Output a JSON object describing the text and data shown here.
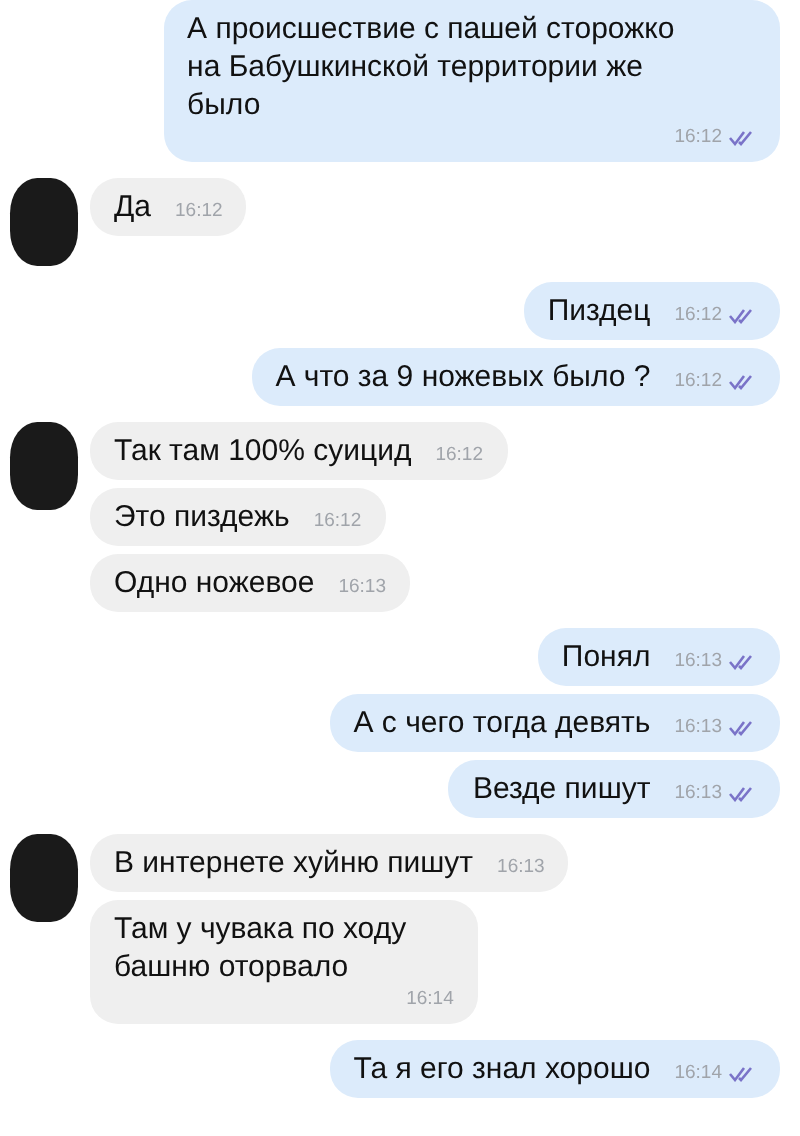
{
  "groups": [
    {
      "kind": "outgoing",
      "messages": [
        {
          "text": "А происшествие с пашей сторожко\nна Бабушкинской территории же\nбыло",
          "time": "16:12",
          "read": true
        }
      ]
    },
    {
      "kind": "incoming",
      "messages": [
        {
          "text": "Да",
          "time": "16:12"
        }
      ]
    },
    {
      "kind": "outgoing",
      "messages": [
        {
          "text": "Пиздец",
          "time": "16:12",
          "read": true
        },
        {
          "text": "А что за 9 ножевых было ?",
          "time": "16:12",
          "read": true
        }
      ]
    },
    {
      "kind": "incoming",
      "messages": [
        {
          "text": "Так там 100% суицид",
          "time": "16:12"
        },
        {
          "text": "Это пиздежь",
          "time": "16:12"
        },
        {
          "text": "Одно ножевое",
          "time": "16:13"
        }
      ]
    },
    {
      "kind": "outgoing",
      "messages": [
        {
          "text": "Понял",
          "time": "16:13",
          "read": true
        },
        {
          "text": "А с чего тогда девять",
          "time": "16:13",
          "read": true
        },
        {
          "text": "Везде пишут",
          "time": "16:13",
          "read": true
        }
      ]
    },
    {
      "kind": "incoming",
      "messages": [
        {
          "text": "В интернете хуйню пишут",
          "time": "16:13"
        },
        {
          "text": "Там у чувака по ходу\nбашню оторвало",
          "time": "16:14"
        }
      ]
    },
    {
      "kind": "outgoing",
      "messages": [
        {
          "text": "Та я его знал хорошо",
          "time": "16:14",
          "read": true
        }
      ]
    }
  ]
}
